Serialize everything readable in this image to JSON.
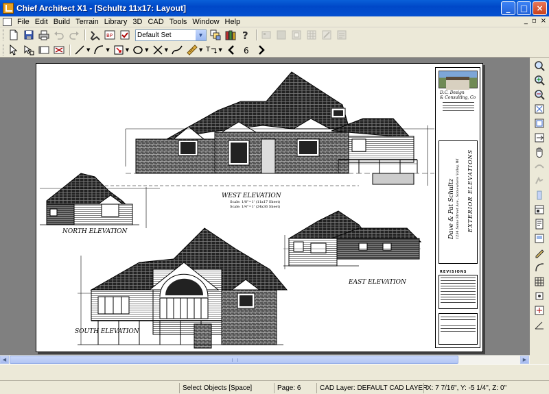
{
  "window": {
    "title": "Chief Architect X1 - [Schultz 11x17: Layout]",
    "minimize": "_",
    "maximize": "□",
    "close": "×"
  },
  "menu": {
    "items": [
      "File",
      "Edit",
      "Build",
      "Terrain",
      "Library",
      "3D",
      "CAD",
      "Tools",
      "Window",
      "Help"
    ],
    "mdi": [
      "_",
      "▫",
      "×"
    ]
  },
  "toolbar": {
    "default_set": "Default Set"
  },
  "drawing": {
    "labels": {
      "west": "WEST ELEVATION",
      "north": "NORTH ELEVATION",
      "east": "EAST ELEVATION",
      "south": "SOUTH ELEVATION"
    },
    "west_scale_1": "Scale: 1/8\"=1' (11x17 Sheet)",
    "west_scale_2": "Scale: 1/4\"=1' (24x36 Sheet)",
    "title_block": {
      "company_1": "D.C. Design",
      "company_2": "& Consulting, Co",
      "client": "Dave & Pat Schultz",
      "address": "1234 Some Street Ave., Somewhere Valley, WI",
      "sheet_title": "EXTERIOR ELEVATIONS",
      "revisions": "REVISIONS"
    }
  },
  "status": {
    "mode": "Select Objects [Space]",
    "page": "Page: 6",
    "cad_layer": "CAD Layer:  DEFAULT CAD LAYER",
    "coords": "X: 7 7/16\", Y: -5 1/4\", Z: 0\""
  }
}
